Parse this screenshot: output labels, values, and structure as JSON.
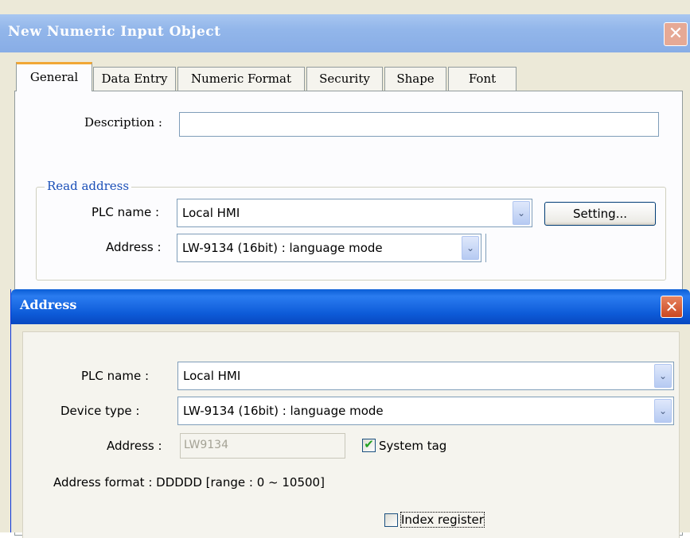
{
  "outer_dialog": {
    "title": "New  Numeric Input Object",
    "close_glyph": "✕",
    "tabs": [
      "General",
      "Data Entry",
      "Numeric Format",
      "Security",
      "Shape",
      "Font"
    ],
    "active_tab": "General",
    "description_label": "Description :",
    "description_value": "",
    "read_address": {
      "group_title": "Read address",
      "plc_name_label": "PLC name :",
      "plc_name_value": "Local HMI",
      "setting_button": "Setting...",
      "address_label": "Address :",
      "address_value": "LW-9134 (16bit) : language mode"
    }
  },
  "address_dialog": {
    "title": "Address",
    "close_glyph": "✕",
    "plc_name_label": "PLC name :",
    "plc_name_value": "Local HMI",
    "device_type_label": "Device type :",
    "device_type_value": "LW-9134 (16bit) : language mode",
    "address_label": "Address :",
    "address_value": "LW9134",
    "system_tag_label": "System tag",
    "system_tag_checked": true,
    "address_format_text": "Address format : DDDDD [range : 0 ~ 10500]",
    "index_register_label": "Index register",
    "index_register_checked": false
  },
  "icons": {
    "dropdown_arrow": "chevron-down-icon",
    "check": "✔",
    "chevron": "⌄"
  },
  "colors": {
    "title_bar_active": "#0a5ed6",
    "title_bar_inactive": "#92b6ea",
    "tab_highlight": "#f1a735",
    "group_title": "#1a4fb8"
  }
}
